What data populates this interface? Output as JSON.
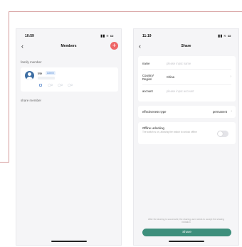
{
  "members_screen": {
    "status_time": "10:59",
    "status_icons": "▮▮ ≈ ▭",
    "back_glyph": "‹",
    "title": "Members",
    "add_glyph": "+",
    "family_section": "family member",
    "member": {
      "name": "Me",
      "badge": "Admin",
      "icon_counts": [
        "0",
        "0",
        "0"
      ]
    },
    "share_section": "share member"
  },
  "share_screen": {
    "status_time": "11:19",
    "status_icons": "▮▮ ≈ ▭",
    "back_glyph": "‹",
    "title": "Share",
    "name_label": "name",
    "name_placeholder": "please input name",
    "country_label": "Country/\nRegion",
    "country_value": "China",
    "account_label": "account",
    "account_placeholder": "please input account",
    "effectiveness_label": "effectiveness type",
    "effectiveness_value": "permanent",
    "offline_title": "Offline unlocking",
    "offline_desc": "The switch is on, allowing the switch to unlock offline",
    "offline_enabled": false,
    "bottom_note": "After the sharing is successful, the sharing user needs to accept the sharing invitation",
    "share_button": "Share",
    "accent_color": "#3e8f7c"
  }
}
